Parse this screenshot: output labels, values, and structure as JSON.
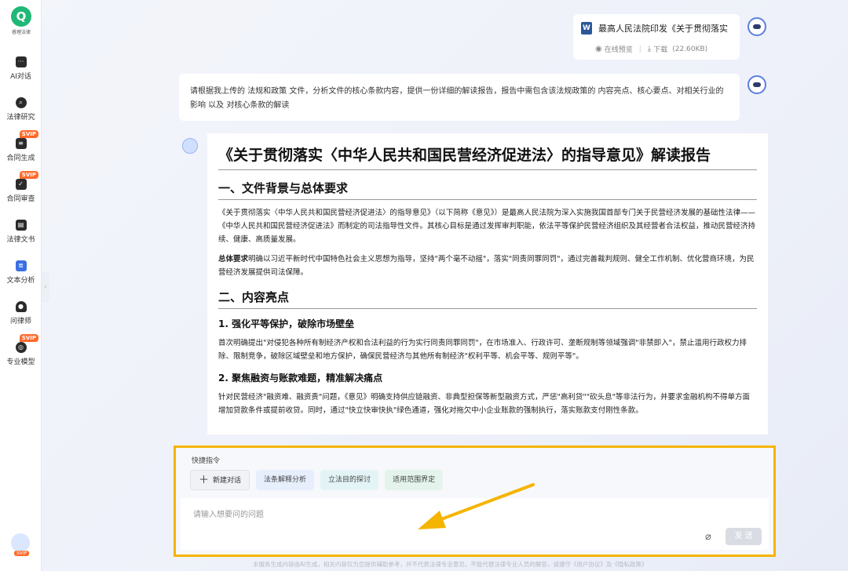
{
  "sidebar": {
    "logo_text": "睿理法律",
    "items": [
      {
        "label": "AI对话",
        "icon": "chat-icon",
        "svip": ""
      },
      {
        "label": "法律研究",
        "icon": "research-icon",
        "svip": ""
      },
      {
        "label": "合同生成",
        "icon": "contract-generate-icon",
        "svip": "SVIP"
      },
      {
        "label": "合同审查",
        "icon": "contract-review-icon",
        "svip": "SVIP"
      },
      {
        "label": "法律文书",
        "icon": "legal-doc-icon",
        "svip": ""
      },
      {
        "label": "文本分析",
        "icon": "text-analysis-icon",
        "svip": ""
      },
      {
        "label": "问律师",
        "icon": "lawyer-icon",
        "svip": ""
      },
      {
        "label": "专业模型",
        "icon": "model-icon",
        "svip": "SVIP"
      }
    ],
    "avatar_badge": "SVIP"
  },
  "file_card": {
    "name": "最高人民法院印发《关于贯彻落实（...",
    "preview": "在线预览",
    "download": "下载",
    "size": "(22.60KB)"
  },
  "user_message": "请根据我上传的  法规和政策 文件，分析文件的核心条款内容，提供一份详细的解读报告，报告中需包含该法规政策的  内容亮点、核心要点、对相关行业的影响  以及  对核心条款的解读",
  "report": {
    "title": "《关于贯彻落实〈中华人民共和国民营经济促进法〉的指导意见》解读报告",
    "h2_1": "一、文件背景与总体要求",
    "p1": "《关于贯彻落实〈中华人民共和国民营经济促进法〉的指导意见》（以下简称《意见》）是最高人民法院为深入实施我国首部专门关于民营经济发展的基础性法律——《中华人民共和国民营经济促进法》而制定的司法指导性文件。其核心目标是通过发挥审判职能，依法平等保护民营经济组织及其经营者合法权益，推动民营经济持续、健康、高质量发展。",
    "p2_bold": "总体要求",
    "p2_rest": "明确以习近平新时代中国特色社会主义思想为指导，坚持\"两个毫不动摇\"，落实\"同责同罪同罚\"，通过完善裁判规则、健全工作机制、优化营商环境，为民营经济发展提供司法保障。",
    "h2_2": "二、内容亮点",
    "h3_1": "1. 强化平等保护，破除市场壁垒",
    "p3": "首次明确提出\"对侵犯各种所有制经济产权和合法利益的行为实行同责同罪同罚\"，在市场准入、行政许可、垄断规制等领域强调\"非禁即入\"，禁止滥用行政权力排除、限制竞争，破除区域壁垒和地方保护，确保民营经济与其他所有制经济\"权利平等、机会平等、规则平等\"。",
    "h3_2": "2. 聚焦融资与账款难题，精准解决痛点",
    "p4": "针对民营经济\"融资难、融资贵\"问题，《意见》明确支持供应链融资、非典型担保等新型融资方式，严惩\"高利贷\"\"砍头息\"等非法行为，并要求金融机构不得单方面增加贷款条件或提前收贷。同时，通过\"快立快审快执\"绿色通道，强化对拖欠中小企业账款的强制执行，落实账款支付刚性条款。"
  },
  "input": {
    "quick_label": "快捷指令",
    "chips": [
      "新建对话",
      "法条解释分析",
      "立法目的探讨",
      "适用范围界定"
    ],
    "placeholder": "请输入想要问的问题",
    "send": "发 送"
  },
  "footer": "本服务生成内容由AI生成，相关内容仅为您提供辅助参考，并不代表法律专业意见，不能代替法律专业人员的解答，请遵守《用户协议》及《隐私政策》",
  "colors": {
    "highlight_border": "#f5b400",
    "arrow": "#f5b400",
    "svip_badge": "#ff6a2b"
  }
}
